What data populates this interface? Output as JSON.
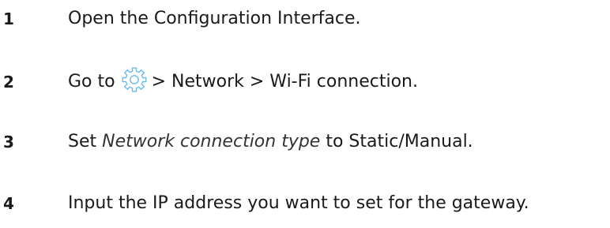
{
  "steps": [
    {
      "number": "1",
      "text": "Open the Configuration Interface."
    },
    {
      "number": "2",
      "prefix": "Go to",
      "icon": "gear-icon",
      "suffix": "> Network > Wi-Fi connection."
    },
    {
      "number": "3",
      "prefix": "Set",
      "emphasis": "Network connection type",
      "suffix": "to Static/Manual."
    },
    {
      "number": "4",
      "text": "Input the IP address you want to set for the gateway."
    }
  ],
  "colors": {
    "text": "#1a1a1a",
    "icon": "#6bbbe8"
  }
}
